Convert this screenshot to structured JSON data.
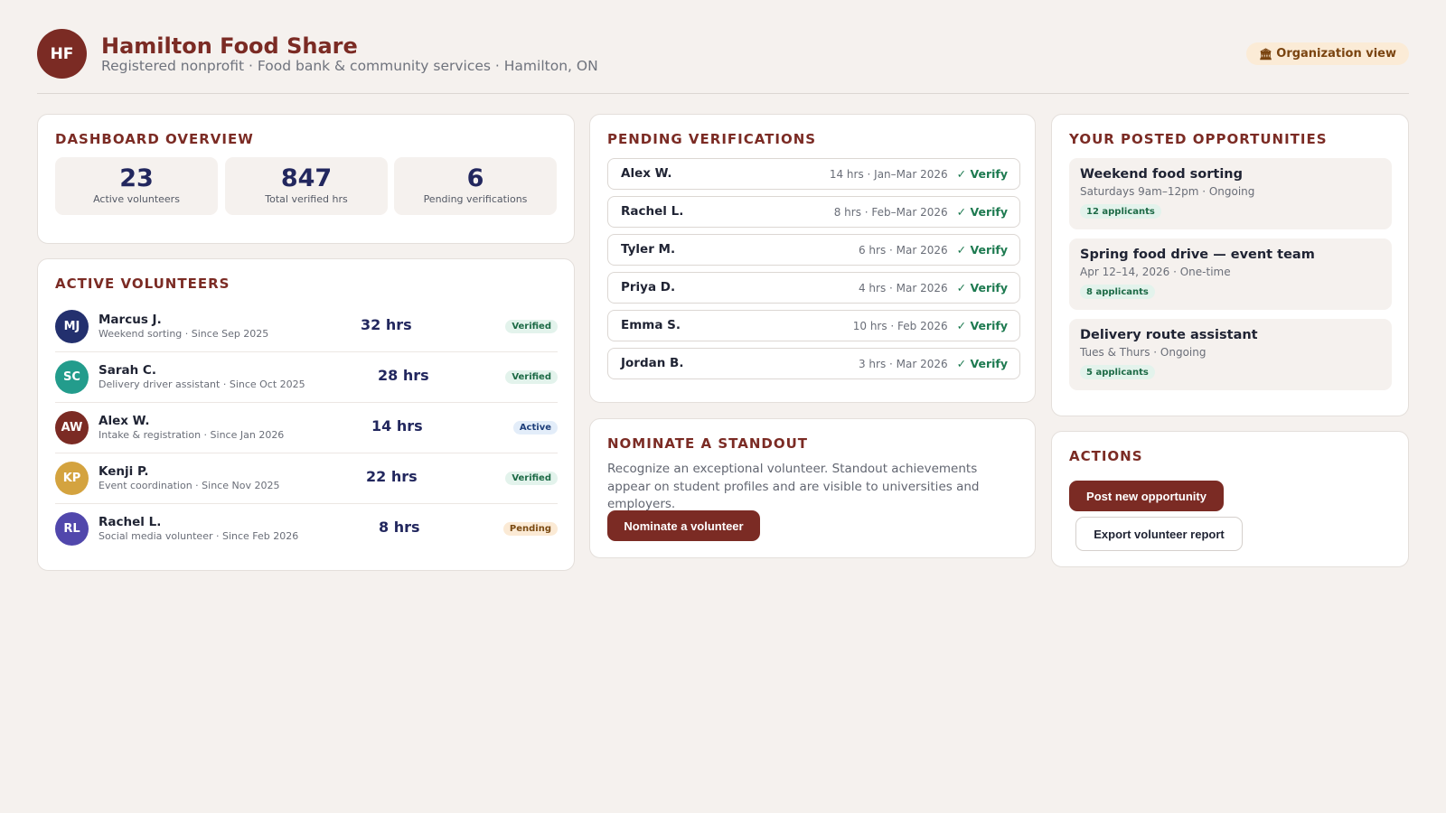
{
  "header": {
    "avatar_initials": "HF",
    "org_name": "Hamilton Food Share",
    "org_sub": "Registered nonprofit · Food bank & community services · Hamilton, ON",
    "view_label": "Organization view",
    "view_icon": "bank-icon"
  },
  "overview": {
    "title": "DASHBOARD OVERVIEW",
    "stats": [
      {
        "value": "23",
        "label": "Active volunteers"
      },
      {
        "value": "847",
        "label": "Total verified hrs"
      },
      {
        "value": "6",
        "label": "Pending verifications"
      }
    ]
  },
  "volunteers": {
    "title": "ACTIVE VOLUNTEERS",
    "items": [
      {
        "initials": "MJ",
        "name": "Marcus J.",
        "meta": "Weekend sorting · Since Sep 2025",
        "hours": "32 hrs",
        "status": "Verified",
        "color": "#23306e"
      },
      {
        "initials": "SC",
        "name": "Sarah C.",
        "meta": "Delivery driver assistant · Since Oct 2025",
        "hours": "28 hrs",
        "status": "Verified",
        "color": "#239c8c"
      },
      {
        "initials": "AW",
        "name": "Alex W.",
        "meta": "Intake & registration · Since Jan 2026",
        "hours": "14 hrs",
        "status": "Active",
        "color": "#7b2b24"
      },
      {
        "initials": "KP",
        "name": "Kenji P.",
        "meta": "Event coordination · Since Nov 2025",
        "hours": "22 hrs",
        "status": "Verified",
        "color": "#d4a33f"
      },
      {
        "initials": "RL",
        "name": "Rachel L.",
        "meta": "Social media volunteer · Since Feb 2026",
        "hours": "8 hrs",
        "status": "Pending",
        "color": "#5147ac"
      }
    ]
  },
  "pending": {
    "title": "PENDING VERIFICATIONS",
    "verify_label": "✓ Verify",
    "items": [
      {
        "name": "Alex W.",
        "meta": "14 hrs · Jan–Mar 2026"
      },
      {
        "name": "Rachel L.",
        "meta": "8 hrs · Feb–Mar 2026"
      },
      {
        "name": "Tyler M.",
        "meta": "6 hrs · Mar 2026"
      },
      {
        "name": "Priya D.",
        "meta": "4 hrs · Mar 2026"
      },
      {
        "name": "Emma S.",
        "meta": "10 hrs · Feb 2026"
      },
      {
        "name": "Jordan B.",
        "meta": "3 hrs · Mar 2026"
      }
    ]
  },
  "nominate": {
    "title": "NOMINATE A STANDOUT",
    "text": "Recognize an exceptional volunteer. Standout achievements appear on student profiles and are visible to universities and employers.",
    "button": "Nominate a volunteer"
  },
  "opportunities": {
    "title": "YOUR POSTED OPPORTUNITIES",
    "items": [
      {
        "title": "Weekend food sorting",
        "meta": "Saturdays 9am–12pm · Ongoing",
        "applicants": "12 applicants"
      },
      {
        "title": "Spring food drive — event team",
        "meta": "Apr 12–14, 2026 · One-time",
        "applicants": "8 applicants"
      },
      {
        "title": "Delivery route assistant",
        "meta": "Tues & Thurs · Ongoing",
        "applicants": "5 applicants"
      }
    ]
  },
  "actions": {
    "title": "ACTIONS",
    "post_button": "Post new opportunity",
    "export_button": "Export volunteer report"
  }
}
